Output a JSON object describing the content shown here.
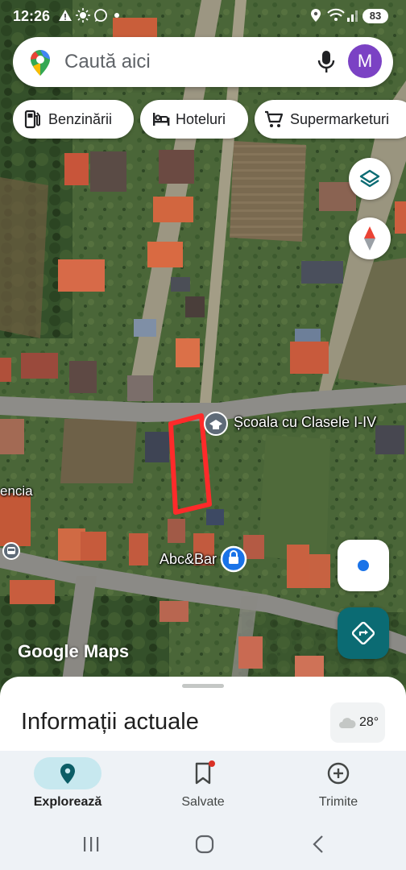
{
  "status_bar": {
    "time": "12:26",
    "battery": "83"
  },
  "search": {
    "placeholder": "Caută aici",
    "avatar_letter": "M"
  },
  "chips": [
    {
      "label": "Benzinării",
      "icon": "gas-station-icon"
    },
    {
      "label": "Hoteluri",
      "icon": "bed-icon"
    },
    {
      "label": "Supermarketuri",
      "icon": "cart-icon"
    }
  ],
  "map": {
    "labels": {
      "school": "Școala cu Clasele I-IV",
      "bar": "Abc&Bar",
      "partial_left": "encia",
      "watermark": "Google Maps"
    },
    "buttons": {
      "layers": "layers-icon",
      "compass": "compass-icon",
      "my_location": "my-location-icon",
      "directions": "directions-icon"
    },
    "colors": {
      "highlight": "#ff2a2a",
      "directions_fab": "#0b6b73",
      "location_dot": "#1a73e8"
    }
  },
  "sheet": {
    "title": "Informații actuale",
    "temperature": "28°",
    "weather_icon": "cloud-icon"
  },
  "nav": {
    "items": [
      {
        "label": "Explorează",
        "icon": "location-pin-icon",
        "active": true
      },
      {
        "label": "Salvate",
        "icon": "bookmark-icon",
        "active": false
      },
      {
        "label": "Trimite",
        "icon": "add-circle-icon",
        "active": false
      }
    ]
  },
  "system_nav": {
    "buttons": [
      "recents-icon",
      "home-icon",
      "back-icon"
    ]
  }
}
